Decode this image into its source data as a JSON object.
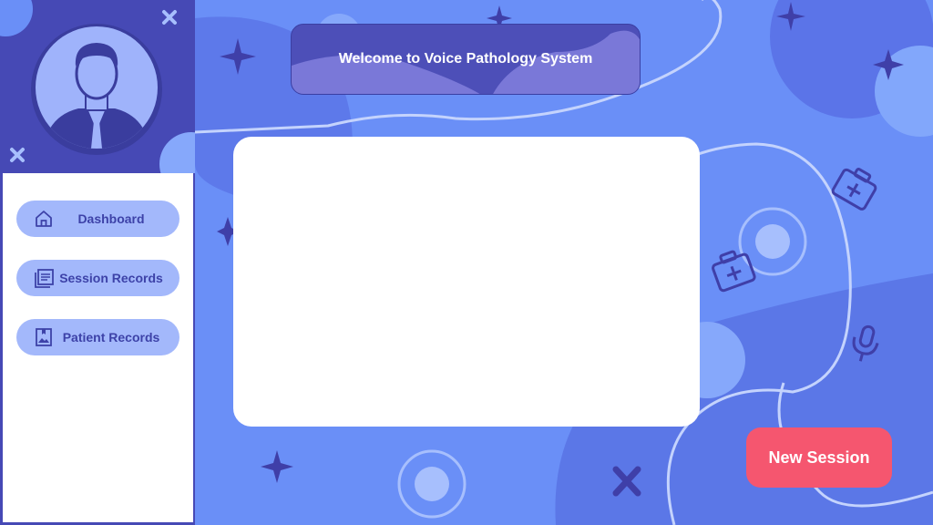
{
  "header": {
    "title": "Welcome to Voice Pathology System"
  },
  "sidebar": {
    "avatar_icon": "user-avatar-icon",
    "items": [
      {
        "label": "Dashboard",
        "icon": "home-icon"
      },
      {
        "label": "Session Records",
        "icon": "records-icon"
      },
      {
        "label": "Patient Records",
        "icon": "patient-file-icon"
      }
    ]
  },
  "main": {
    "new_session_label": "New Session"
  },
  "colors": {
    "background": "#6a8ff7",
    "sidebar": "#4649b5",
    "nav_button": "#a3b8fb",
    "accent_button": "#f5566f",
    "decoration_dark": "#3f3fa8"
  }
}
